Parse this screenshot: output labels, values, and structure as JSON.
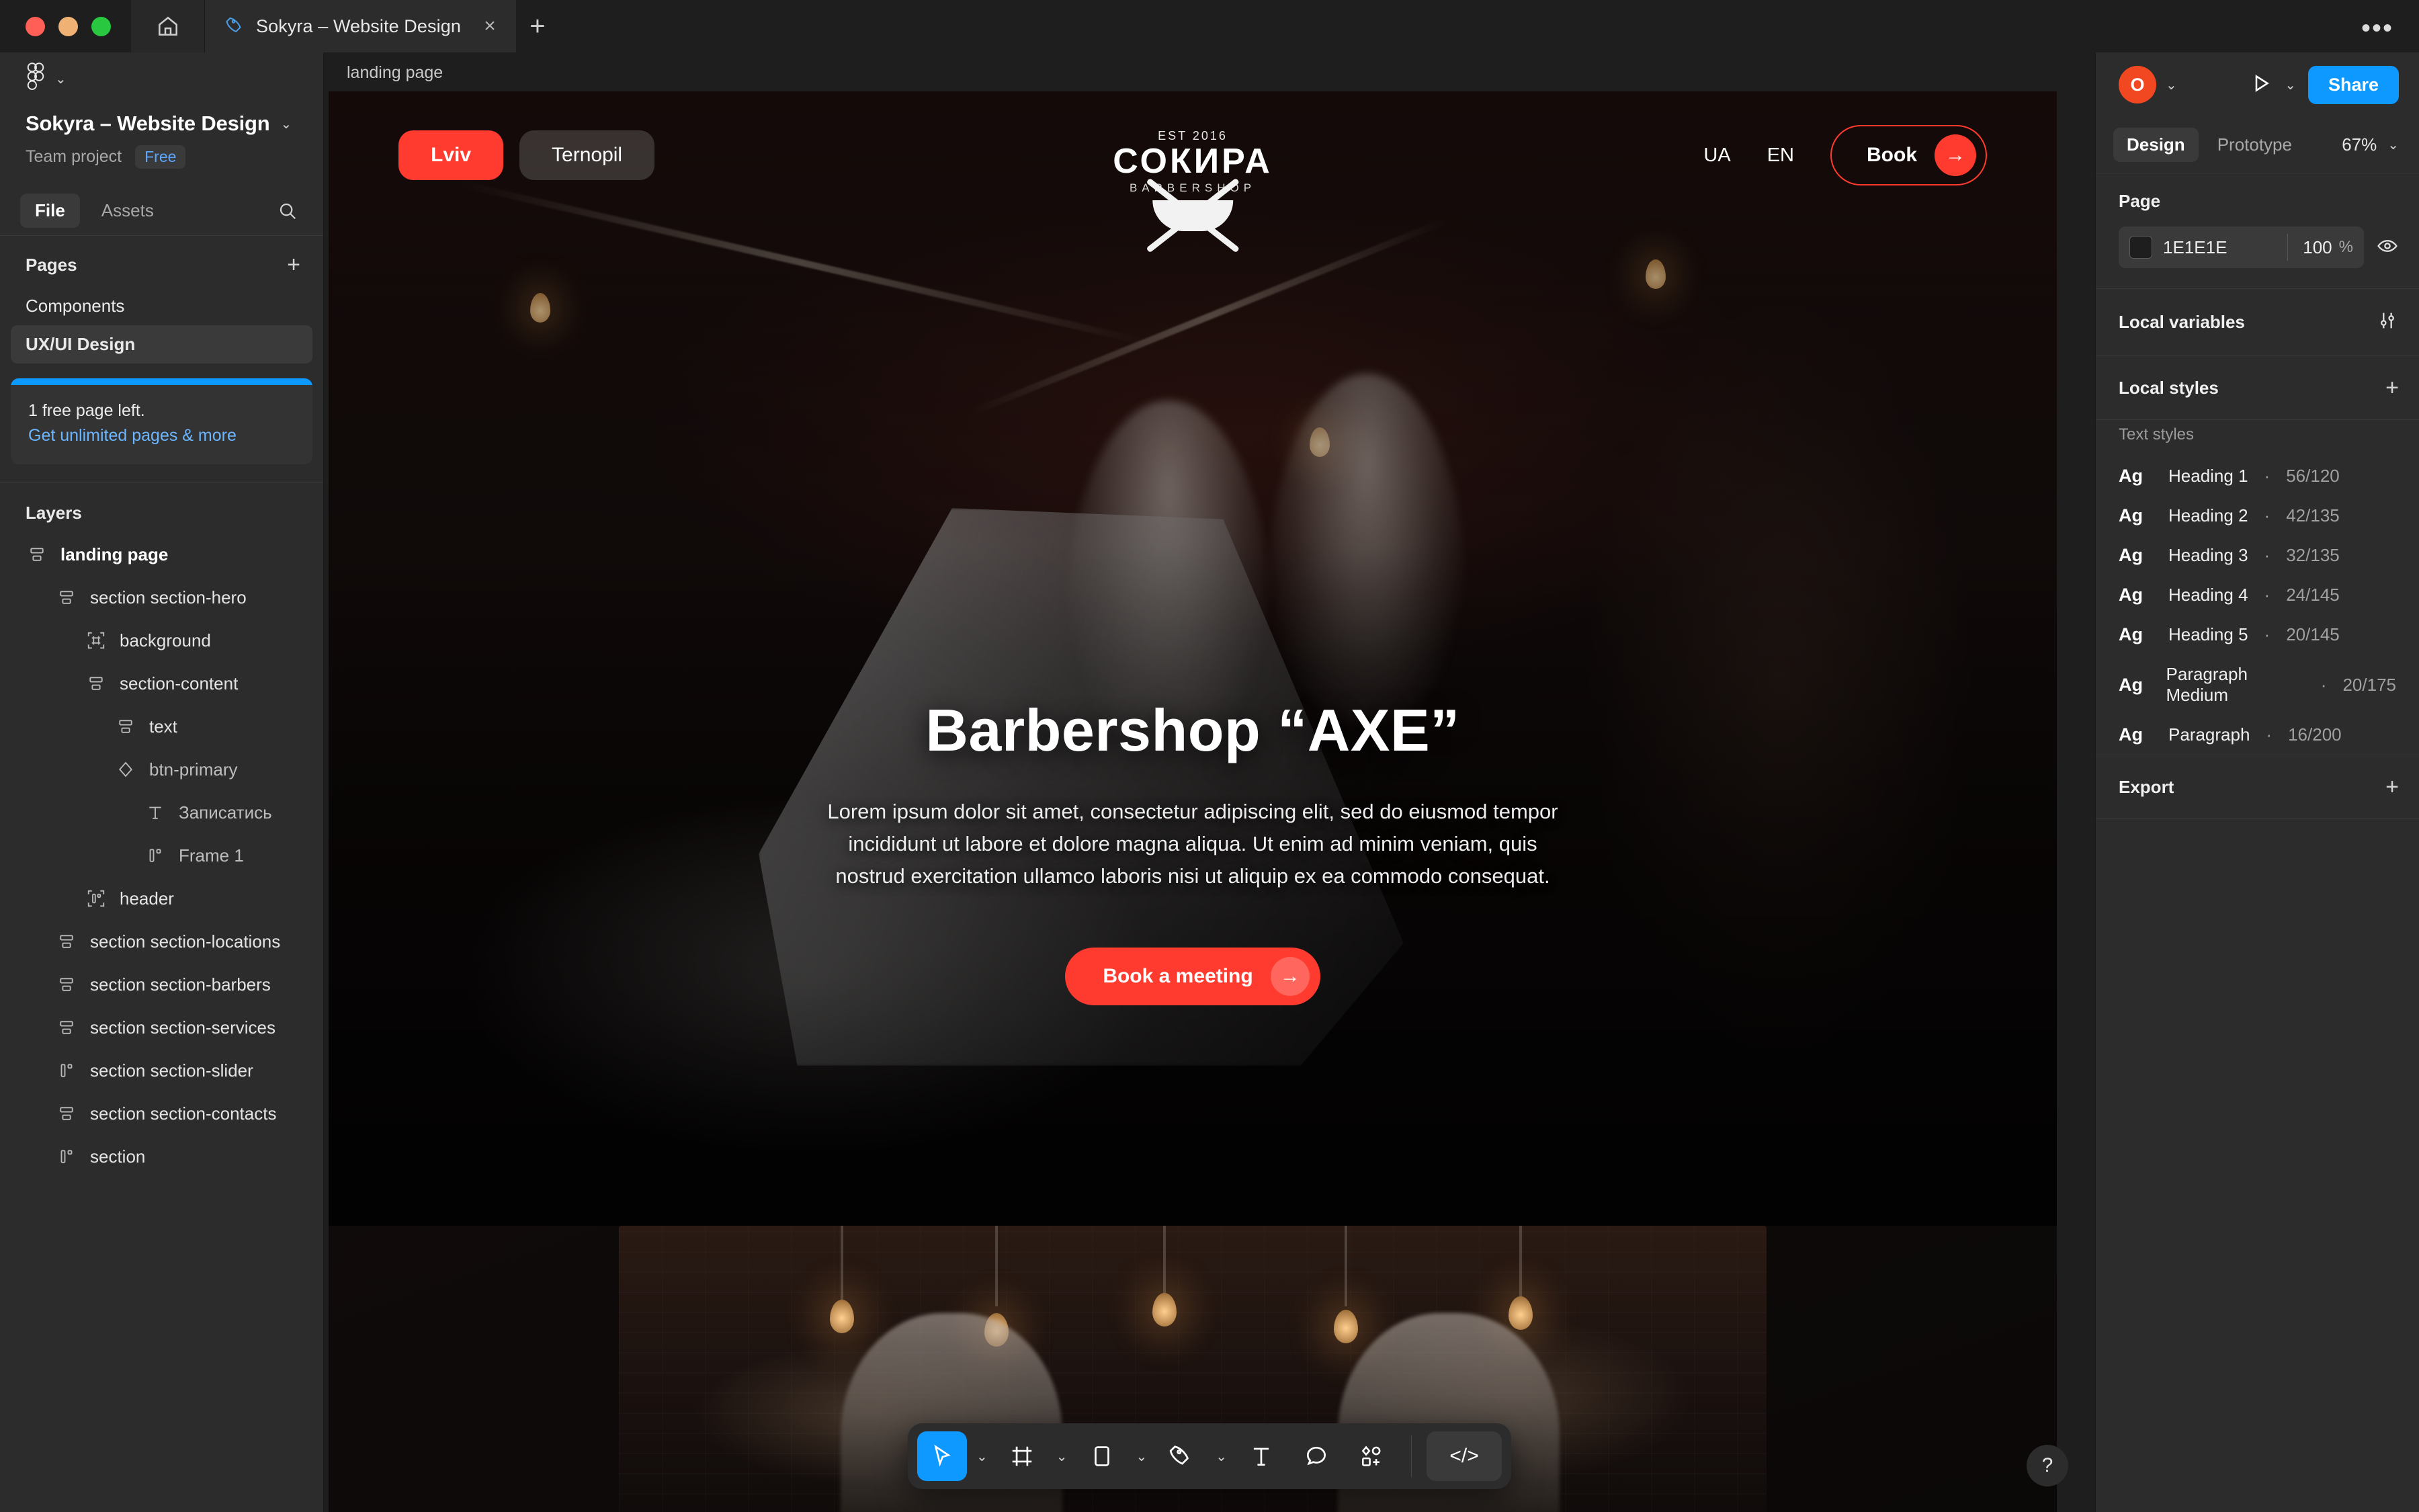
{
  "window": {
    "home_icon": "home-icon",
    "tab_title": "Sokyra – Website Design",
    "tab_file_icon": "figma-pen-icon",
    "close_icon": "×",
    "new_tab_icon": "+",
    "overflow_icon": "•••"
  },
  "sidebar": {
    "figma_logo": "figma-logo",
    "file_title": "Sokyra – Website Design",
    "team_project": "Team project",
    "plan_badge": "Free",
    "tabs": [
      {
        "label": "File",
        "active": true
      },
      {
        "label": "Assets",
        "active": false
      }
    ],
    "search_icon": "search-icon",
    "pages_header": "Pages",
    "pages_add_icon": "+",
    "pages": [
      {
        "label": "Components",
        "selected": false
      },
      {
        "label": "UX/UI Design",
        "selected": true
      }
    ],
    "promo": {
      "title": "1 free page left.",
      "link": "Get unlimited pages & more"
    },
    "layers_header": "Layers",
    "layers": [
      {
        "label": "landing page",
        "icon": "frame-icon",
        "depth": 0,
        "bold": true
      },
      {
        "label": "section section-hero",
        "icon": "frame-icon",
        "depth": 1,
        "bold": false
      },
      {
        "label": "background",
        "icon": "group-icon",
        "depth": 2,
        "bold": false
      },
      {
        "label": "section-content",
        "icon": "frame-icon",
        "depth": 2,
        "bold": false
      },
      {
        "label": "text",
        "icon": "frame-icon",
        "depth": 3,
        "bold": false
      },
      {
        "label": "btn-primary",
        "icon": "component-icon",
        "depth": 3,
        "bold": false,
        "dim": true
      },
      {
        "label": "Записатись",
        "icon": "text-icon",
        "depth": 4,
        "bold": false,
        "dim": true
      },
      {
        "label": "Frame 1",
        "icon": "autolayout-icon",
        "depth": 4,
        "bold": false,
        "dim": true
      },
      {
        "label": "header",
        "icon": "group-autolayout-icon",
        "depth": 2,
        "bold": false
      },
      {
        "label": "section section-locations",
        "icon": "frame-icon",
        "depth": 1,
        "bold": false
      },
      {
        "label": "section section-barbers",
        "icon": "frame-icon",
        "depth": 1,
        "bold": false
      },
      {
        "label": "section section-services",
        "icon": "frame-icon",
        "depth": 1,
        "bold": false
      },
      {
        "label": "section section-slider",
        "icon": "autolayout-icon",
        "depth": 1,
        "bold": false
      },
      {
        "label": "section section-contacts",
        "icon": "frame-icon",
        "depth": 1,
        "bold": false
      },
      {
        "label": "section",
        "icon": "autolayout-icon",
        "depth": 1,
        "bold": false
      }
    ]
  },
  "canvas": {
    "frame_label": "landing page",
    "hero": {
      "cities": [
        {
          "label": "Lviv",
          "active": true
        },
        {
          "label": "Ternopil",
          "active": false
        }
      ],
      "logo": {
        "est": "EST 2016",
        "name": "СОКИРА",
        "sub": "BARBERSHOP"
      },
      "languages": [
        "UA",
        "EN"
      ],
      "book_button": "Book",
      "book_arrow_icon": "arrow-right-icon",
      "title": "Barbershop “AXE”",
      "paragraph": "Lorem ipsum dolor sit amet, consectetur adipiscing elit, sed do eiusmod tempor incididunt ut labore et dolore magna aliqua. Ut enim ad minim veniam, quis nostrud exercitation ullamco laboris nisi ut aliquip ex ea commodo consequat.",
      "cta_label": "Book a meeting",
      "cta_arrow_icon": "arrow-right-icon"
    }
  },
  "toolbar": {
    "tools": [
      {
        "name": "move-tool",
        "icon": "cursor-icon",
        "active": true,
        "chevron": true
      },
      {
        "name": "frame-tool",
        "icon": "frame-icon",
        "active": false,
        "chevron": true
      },
      {
        "name": "shape-tool",
        "icon": "rectangle-icon",
        "active": false,
        "chevron": true
      },
      {
        "name": "pen-tool",
        "icon": "pen-icon",
        "active": false,
        "chevron": true
      },
      {
        "name": "text-tool",
        "icon": "text-t-icon",
        "active": false,
        "chevron": false
      },
      {
        "name": "comment-tool",
        "icon": "comment-icon",
        "active": false,
        "chevron": false
      },
      {
        "name": "actions-tool",
        "icon": "plugins-icon",
        "active": false,
        "chevron": false
      }
    ],
    "dev_mode_label": "</>",
    "help_label": "?"
  },
  "right_panel": {
    "avatar_initial": "O",
    "present_icon": "play-icon",
    "share_label": "Share",
    "tabs": [
      {
        "label": "Design",
        "active": true
      },
      {
        "label": "Prototype",
        "active": false
      }
    ],
    "zoom_level": "67%",
    "page": {
      "title": "Page",
      "fill_hex": "1E1E1E",
      "fill_color": "#1E1E1E",
      "opacity": "100",
      "opacity_unit": "%",
      "visibility_icon": "eye-icon"
    },
    "local_variables": {
      "title": "Local variables",
      "icon": "variables-icon"
    },
    "local_styles": {
      "title": "Local styles",
      "add_icon": "+",
      "subtitle": "Text styles",
      "text_styles": [
        {
          "preview": "Ag",
          "name": "Heading 1",
          "meta": "56/120"
        },
        {
          "preview": "Ag",
          "name": "Heading 2",
          "meta": "42/135"
        },
        {
          "preview": "Ag",
          "name": "Heading 3",
          "meta": "32/135"
        },
        {
          "preview": "Ag",
          "name": "Heading 4",
          "meta": "24/145"
        },
        {
          "preview": "Ag",
          "name": "Heading 5",
          "meta": "20/145"
        },
        {
          "preview": "Ag",
          "name": "Paragraph Medium",
          "meta": "20/175"
        },
        {
          "preview": "Ag",
          "name": "Paragraph",
          "meta": "16/200"
        }
      ]
    },
    "export": {
      "title": "Export",
      "add_icon": "+"
    }
  },
  "colors": {
    "accent_red": "#FF3B30",
    "figma_blue": "#0D99FF",
    "panel_bg": "#2C2C2C"
  }
}
